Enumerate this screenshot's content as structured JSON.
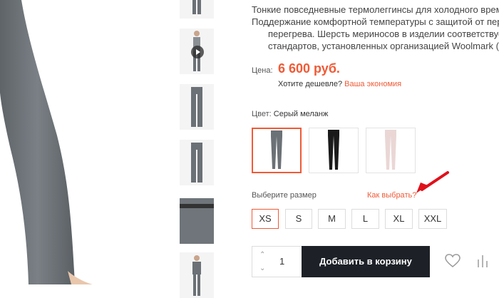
{
  "description": {
    "lines": [
      "Тонкие повседневные термолеггинсы для холодного врем",
      "Поддержание комфортной температуры с защитой от пер",
      "перегрева. Шерсть мериносов в изделии соответствует н",
      "стандартов, установленных организацией Woolmark (Авст"
    ]
  },
  "price": {
    "label": "Цена:",
    "value": "6 600 руб."
  },
  "cheaper": {
    "text": "Хотите дешевле?",
    "link": "Ваша экономия"
  },
  "color": {
    "label": "Цвет:",
    "value": "Серый меланж",
    "swatches": [
      {
        "name": "grey",
        "color": "#6b7176"
      },
      {
        "name": "black",
        "color": "#1a1a1a"
      },
      {
        "name": "pink",
        "color": "#ead7d5"
      }
    ]
  },
  "size": {
    "label": "Выберите размер",
    "how_to_choose": "Как выбрать?",
    "options": [
      "XS",
      "S",
      "M",
      "L",
      "XL",
      "XXL"
    ],
    "selected": "XS"
  },
  "quantity": {
    "value": "1",
    "up_icon": "chevron-up-icon",
    "down_icon": "chevron-down-icon"
  },
  "cart": {
    "add_label": "Добавить в корзину"
  },
  "actions": {
    "favorite_icon": "heart-icon",
    "compare_icon": "compare-bars-icon"
  },
  "accent_color": "#f05a36",
  "colors": {
    "accent": "#f05a36",
    "button_dark": "#1d2127",
    "product_grey": "#6b7176"
  }
}
